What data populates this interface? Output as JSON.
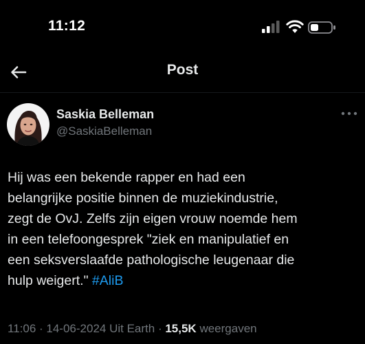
{
  "status_bar": {
    "time": "11:12"
  },
  "header": {
    "title": "Post"
  },
  "author": {
    "display_name": "Saskia Belleman",
    "handle": "@SaskiaBelleman"
  },
  "tweet": {
    "lines": [
      "Hij was een bekende rapper en had een",
      "belangrijke positie binnen de muziekindustrie,",
      "zegt de OvJ. Zelfs zijn eigen vrouw noemde hem",
      "in een telefoongesprek \"ziek en manipulatief en",
      "een seksverslaafde pathologische leugenaar die"
    ],
    "last_line_text": "hulp weigert.\"",
    "hashtag": "#AliB"
  },
  "meta": {
    "time": "11:06",
    "separator": " · ",
    "date": "14-06-2024",
    "source": "Uit Earth",
    "views_count": "15,5K",
    "views_label": "weergaven"
  },
  "colors": {
    "background": "#000000",
    "text": "#e7e9ea",
    "secondary": "#71767b",
    "link": "#1d9bf0"
  },
  "icons": {
    "back": "arrow-left-icon",
    "more": "more-horizontal-icon",
    "signal": "cellular-signal-icon",
    "wifi": "wifi-icon",
    "battery": "battery-icon"
  }
}
